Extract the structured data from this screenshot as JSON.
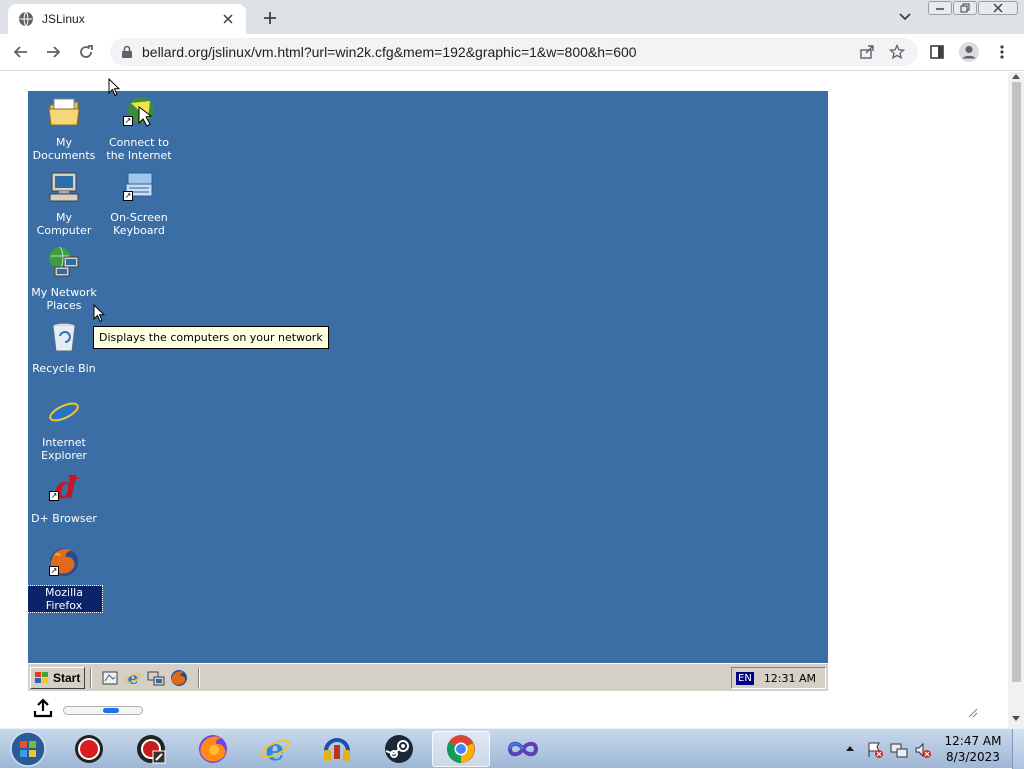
{
  "browser": {
    "tab_title": "JSLinux",
    "url": "bellard.org/jslinux/vm.html?url=win2k.cfg&mem=192&graphic=1&w=800&h=600"
  },
  "desktop": {
    "background": "#3a6ea5",
    "icons": [
      {
        "label": "My Documents"
      },
      {
        "label": "Connect to the Internet"
      },
      {
        "label": "My Computer"
      },
      {
        "label": "On-Screen Keyboard"
      },
      {
        "label": "My Network Places"
      },
      {
        "label": "Recycle Bin"
      },
      {
        "label": "Internet Explorer"
      },
      {
        "label": "D+ Browser"
      },
      {
        "label": "Mozilla Firefox"
      }
    ],
    "tooltip": "Displays the computers on your network"
  },
  "vm_taskbar": {
    "start_label": "Start",
    "quicklaunch": [
      "show-desktop-icon",
      "internet-explorer-icon",
      "network-icon",
      "firefox-icon"
    ],
    "lang": "EN",
    "clock": "12:31 AM"
  },
  "controls": {
    "progress_fraction": 0.6
  },
  "host_taskbar": {
    "apps": [
      "record-icon",
      "obs-icon",
      "firefox-icon",
      "internet-explorer-icon",
      "audio-icon",
      "steam-icon",
      "chrome-icon",
      "infinity-icon"
    ],
    "active_app": "chrome-icon",
    "time": "12:47 AM",
    "date": "8/3/2023"
  }
}
